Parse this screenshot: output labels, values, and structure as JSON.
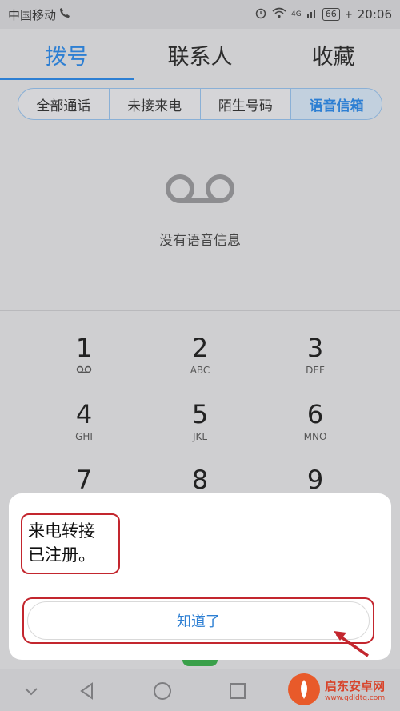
{
  "status": {
    "carrier": "中国移动",
    "net": "4G",
    "battery": "66",
    "time": "20:06"
  },
  "tabs": [
    {
      "label": "拨号",
      "active": true
    },
    {
      "label": "联系人",
      "active": false
    },
    {
      "label": "收藏",
      "active": false
    }
  ],
  "filters": [
    {
      "label": "全部通话",
      "active": false
    },
    {
      "label": "未接来电",
      "active": false
    },
    {
      "label": "陌生号码",
      "active": false
    },
    {
      "label": "语音信箱",
      "active": true
    }
  ],
  "voicemail": {
    "empty_text": "没有语音信息"
  },
  "keypad": [
    {
      "digit": "1",
      "letters": ""
    },
    {
      "digit": "2",
      "letters": "ABC"
    },
    {
      "digit": "3",
      "letters": "DEF"
    },
    {
      "digit": "4",
      "letters": "GHI"
    },
    {
      "digit": "5",
      "letters": "JKL"
    },
    {
      "digit": "6",
      "letters": "MNO"
    },
    {
      "digit": "7",
      "letters": ""
    },
    {
      "digit": "8",
      "letters": ""
    },
    {
      "digit": "9",
      "letters": ""
    }
  ],
  "dialog": {
    "line1": "来电转接",
    "line2": "已注册。",
    "ok_label": "知道了"
  },
  "watermark": {
    "name": "启东安卓网",
    "url": "www.qdldtq.com"
  },
  "colors": {
    "accent": "#2d7fd3",
    "highlight": "#c3262e"
  }
}
